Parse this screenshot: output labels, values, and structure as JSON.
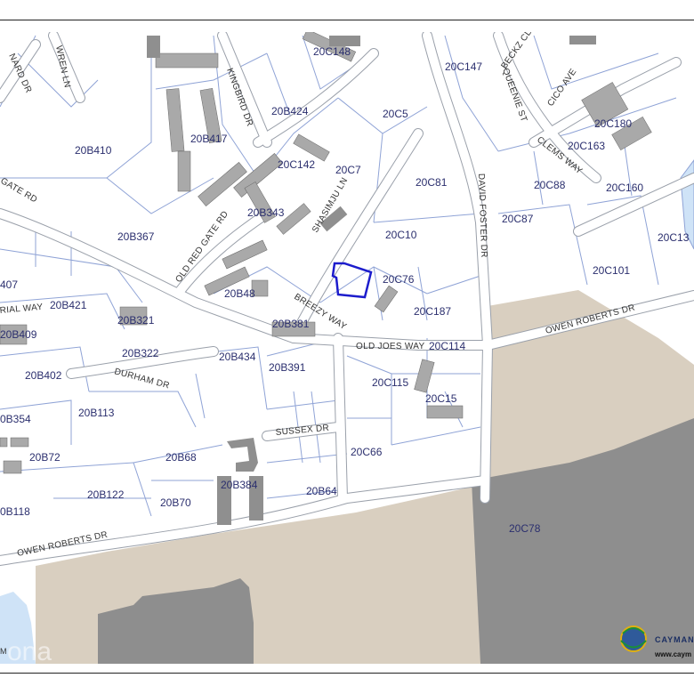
{
  "map": {
    "parcels": [
      {
        "id": "20C148"
      },
      {
        "id": "20C147"
      },
      {
        "id": "20B424"
      },
      {
        "id": "20C5"
      },
      {
        "id": "20C180"
      },
      {
        "id": "20B410"
      },
      {
        "id": "20B417"
      },
      {
        "id": "20C163"
      },
      {
        "id": "20C142"
      },
      {
        "id": "20C7"
      },
      {
        "id": "20C81"
      },
      {
        "id": "20C88"
      },
      {
        "id": "20C160"
      },
      {
        "id": "20B343"
      },
      {
        "id": "20C87"
      },
      {
        "id": "20B367"
      },
      {
        "id": "20C10"
      },
      {
        "id": "20C13"
      },
      {
        "id": "20C101"
      },
      {
        "id": "407"
      },
      {
        "id": "20B48"
      },
      {
        "id": "20C76"
      },
      {
        "id": "20B421"
      },
      {
        "id": "20B321"
      },
      {
        "id": "20C187"
      },
      {
        "id": "20B381"
      },
      {
        "id": "20B409"
      },
      {
        "id": "20C114"
      },
      {
        "id": "20B322"
      },
      {
        "id": "20B434"
      },
      {
        "id": "20B391"
      },
      {
        "id": "20B402"
      },
      {
        "id": "20C115"
      },
      {
        "id": "20C15"
      },
      {
        "id": "20B113"
      },
      {
        "id": "0B354"
      },
      {
        "id": "20B72"
      },
      {
        "id": "20B68"
      },
      {
        "id": "20C66"
      },
      {
        "id": "20B384"
      },
      {
        "id": "20B122"
      },
      {
        "id": "20B64"
      },
      {
        "id": "20B70"
      },
      {
        "id": "20C78"
      },
      {
        "id": "0B118"
      }
    ],
    "roads": [
      {
        "name": "WREN LN"
      },
      {
        "name": "NARD DR"
      },
      {
        "name": "KINGBIRD DR"
      },
      {
        "name": "BECKZ CL"
      },
      {
        "name": "QUEENIE ST"
      },
      {
        "name": "CICO AVE"
      },
      {
        "name": "CLEMS WAY"
      },
      {
        "name": "GATE RD"
      },
      {
        "name": "SHASIMJU LN"
      },
      {
        "name": "DAVID FOSTER DR"
      },
      {
        "name": "OLD RED GATE RD"
      },
      {
        "name": "BREEZY WAY"
      },
      {
        "name": "OWEN ROBERTS DR"
      },
      {
        "name": "RIAL WAY"
      },
      {
        "name": "OLD JOES WAY"
      },
      {
        "name": "DURHAM DR"
      },
      {
        "name": "SUSSEX DR"
      },
      {
        "name": "OWEN ROBERTS DR"
      }
    ],
    "colors": {
      "parcel_line": "#8fa3d6",
      "road_fill": "#ffffff",
      "road_edge": "#9aa0aa",
      "airport_land": "#d9cfc0",
      "building_large": "#8f8f8f",
      "building_small": "#a9a9a9",
      "selected_parcel": "#1c1ccc",
      "water": "#cfe3f7"
    }
  },
  "logo": {
    "name": "CAYMAN",
    "url": "www.caym",
    "icon": "globe-icon"
  },
  "watermark": {
    "text": "ona",
    "corner_text": "M"
  }
}
